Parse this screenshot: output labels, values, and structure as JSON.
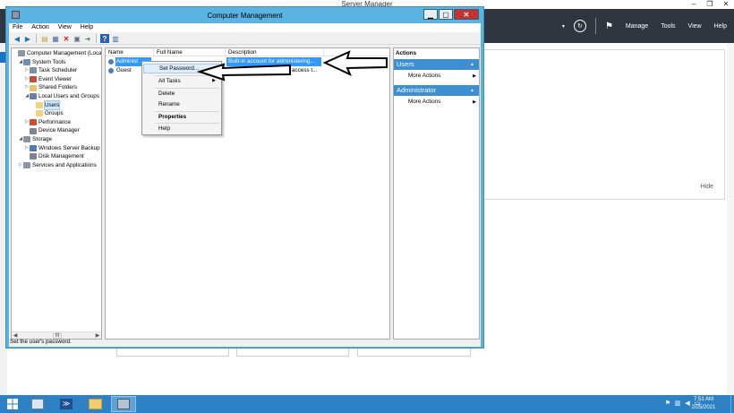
{
  "server_manager": {
    "title": "Server Manager",
    "nav": {
      "manage": "Manage",
      "tools": "Tools",
      "view": "View",
      "help": "Help"
    },
    "hide": "Hide",
    "window_controls": {
      "minimize": "–",
      "restore": "❐",
      "close": "✕"
    }
  },
  "cm": {
    "title": "Computer Management",
    "menu": [
      "File",
      "Action",
      "View",
      "Help"
    ],
    "tree": [
      {
        "label": "Computer Management (Local",
        "depth": 0,
        "tw": "",
        "color": "#8a96a8"
      },
      {
        "label": "System Tools",
        "depth": 1,
        "tw": "◢",
        "color": "#6d8fb5"
      },
      {
        "label": "Task Scheduler",
        "depth": 2,
        "tw": "▷",
        "color": "#7b8fa6"
      },
      {
        "label": "Event Viewer",
        "depth": 2,
        "tw": "▷",
        "color": "#c0503c"
      },
      {
        "label": "Shared Folders",
        "depth": 2,
        "tw": "▷",
        "color": "#e3c46a"
      },
      {
        "label": "Local Users and Groups",
        "depth": 2,
        "tw": "◢",
        "color": "#6a7fa8"
      },
      {
        "label": "Users",
        "depth": 3,
        "tw": "",
        "color": "#f2d27a",
        "selected": true
      },
      {
        "label": "Groups",
        "depth": 3,
        "tw": "",
        "color": "#f2d27a"
      },
      {
        "label": "Performance",
        "depth": 2,
        "tw": "▷",
        "color": "#d04a3a"
      },
      {
        "label": "Device Manager",
        "depth": 2,
        "tw": "",
        "color": "#7a8596"
      },
      {
        "label": "Storage",
        "depth": 1,
        "tw": "◢",
        "color": "#8a96a8"
      },
      {
        "label": "Windows Server Backup",
        "depth": 2,
        "tw": "▷",
        "color": "#4f7bb5"
      },
      {
        "label": "Disk Management",
        "depth": 2,
        "tw": "",
        "color": "#7a8596"
      },
      {
        "label": "Services and Applications",
        "depth": 1,
        "tw": "▷",
        "color": "#8a96a8"
      }
    ],
    "columns": {
      "name": "Name",
      "full_name": "Full Name",
      "description": "Description"
    },
    "rows": [
      {
        "name": "Administ",
        "full_name": "",
        "description": "Built-in account for administering..."
      },
      {
        "name": "Guest",
        "full_name": "",
        "description": "Built-in account for guest access t..."
      }
    ],
    "actions": {
      "title": "Actions",
      "sections": [
        {
          "header": "Users",
          "item": "More Actions"
        },
        {
          "header": "Administrator",
          "item": "More Actions"
        }
      ]
    },
    "context_menu": {
      "set_password": "Set Password...",
      "all_tasks": "All Tasks",
      "delete": "Delete",
      "rename": "Rename",
      "properties": "Properties",
      "help": "Help"
    },
    "status": "Set the user's password."
  },
  "taskbar": {
    "time": "7:51 AM",
    "date": "2/25/2021"
  }
}
